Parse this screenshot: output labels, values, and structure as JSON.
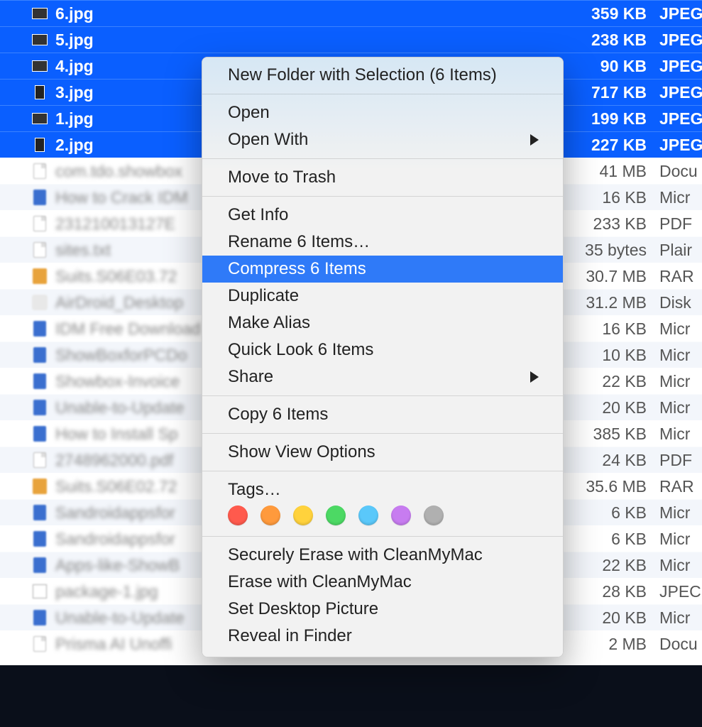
{
  "finder": {
    "selected_rows": [
      {
        "name": "6.jpg",
        "size": "359 KB",
        "kind": "JPEG"
      },
      {
        "name": "5.jpg",
        "size": "238 KB",
        "kind": "JPEG"
      },
      {
        "name": "4.jpg",
        "size": "90 KB",
        "kind": "JPEG"
      },
      {
        "name": "3.jpg",
        "size": "717 KB",
        "kind": "JPEG"
      },
      {
        "name": "1.jpg",
        "size": "199 KB",
        "kind": "JPEG"
      },
      {
        "name": "2.jpg",
        "size": "227 KB",
        "kind": "JPEG"
      }
    ],
    "other_rows": [
      {
        "name": "com.tdo.showbox",
        "size": "41 MB",
        "kind": "Docu"
      },
      {
        "name": "How to Crack IDM",
        "size": "16 KB",
        "kind": "Micr"
      },
      {
        "name": "231210013127E",
        "size": "233 KB",
        "kind": "PDF"
      },
      {
        "name": "sites.txt",
        "size": "35 bytes",
        "kind": "Plair"
      },
      {
        "name": "Suits.S06E03.72",
        "size": "30.7 MB",
        "kind": "RAR"
      },
      {
        "name": "AirDroid_Desktop",
        "size": "31.2 MB",
        "kind": "Disk"
      },
      {
        "name": "IDM Free Download",
        "size": "16 KB",
        "kind": "Micr"
      },
      {
        "name": "ShowBoxforPCDo",
        "size": "10 KB",
        "kind": "Micr"
      },
      {
        "name": "Showbox-Invoice",
        "size": "22 KB",
        "kind": "Micr"
      },
      {
        "name": "Unable-to-Update",
        "size": "20 KB",
        "kind": "Micr"
      },
      {
        "name": "How to Install Sp",
        "size": "385 KB",
        "kind": "Micr"
      },
      {
        "name": "2748962000.pdf",
        "size": "24 KB",
        "kind": "PDF"
      },
      {
        "name": "Suits.S06E02.72",
        "size": "35.6 MB",
        "kind": "RAR"
      },
      {
        "name": "Sandroidappsfor",
        "size": "6 KB",
        "kind": "Micr"
      },
      {
        "name": "Sandroidappsfor",
        "size": "6 KB",
        "kind": "Micr"
      },
      {
        "name": "Apps-like-ShowB",
        "size": "22 KB",
        "kind": "Micr"
      },
      {
        "name": "package-1.jpg",
        "size": "28 KB",
        "kind": "JPEC"
      },
      {
        "name": "Unable-to-Update",
        "size": "20 KB",
        "kind": "Micr"
      },
      {
        "name": "Prisma AI Unoffi",
        "size": "2 MB",
        "kind": "Docu"
      }
    ]
  },
  "menu": {
    "new_folder": "New Folder with Selection (6 Items)",
    "open": "Open",
    "open_with": "Open With",
    "trash": "Move to Trash",
    "get_info": "Get Info",
    "rename": "Rename 6 Items…",
    "compress": "Compress 6 Items",
    "duplicate": "Duplicate",
    "alias": "Make Alias",
    "quicklook": "Quick Look 6 Items",
    "share": "Share",
    "copy": "Copy 6 Items",
    "view_options": "Show View Options",
    "tags_label": "Tags…",
    "erase_secure": "Securely Erase with CleanMyMac",
    "erase": "Erase with CleanMyMac",
    "desktop_pic": "Set Desktop Picture",
    "reveal": "Reveal in Finder",
    "tag_colors": [
      "#ff5a4d",
      "#ff9a3c",
      "#ffd23c",
      "#4cd964",
      "#5ac8fa",
      "#c77cf0",
      "#b0b0b0"
    ]
  }
}
